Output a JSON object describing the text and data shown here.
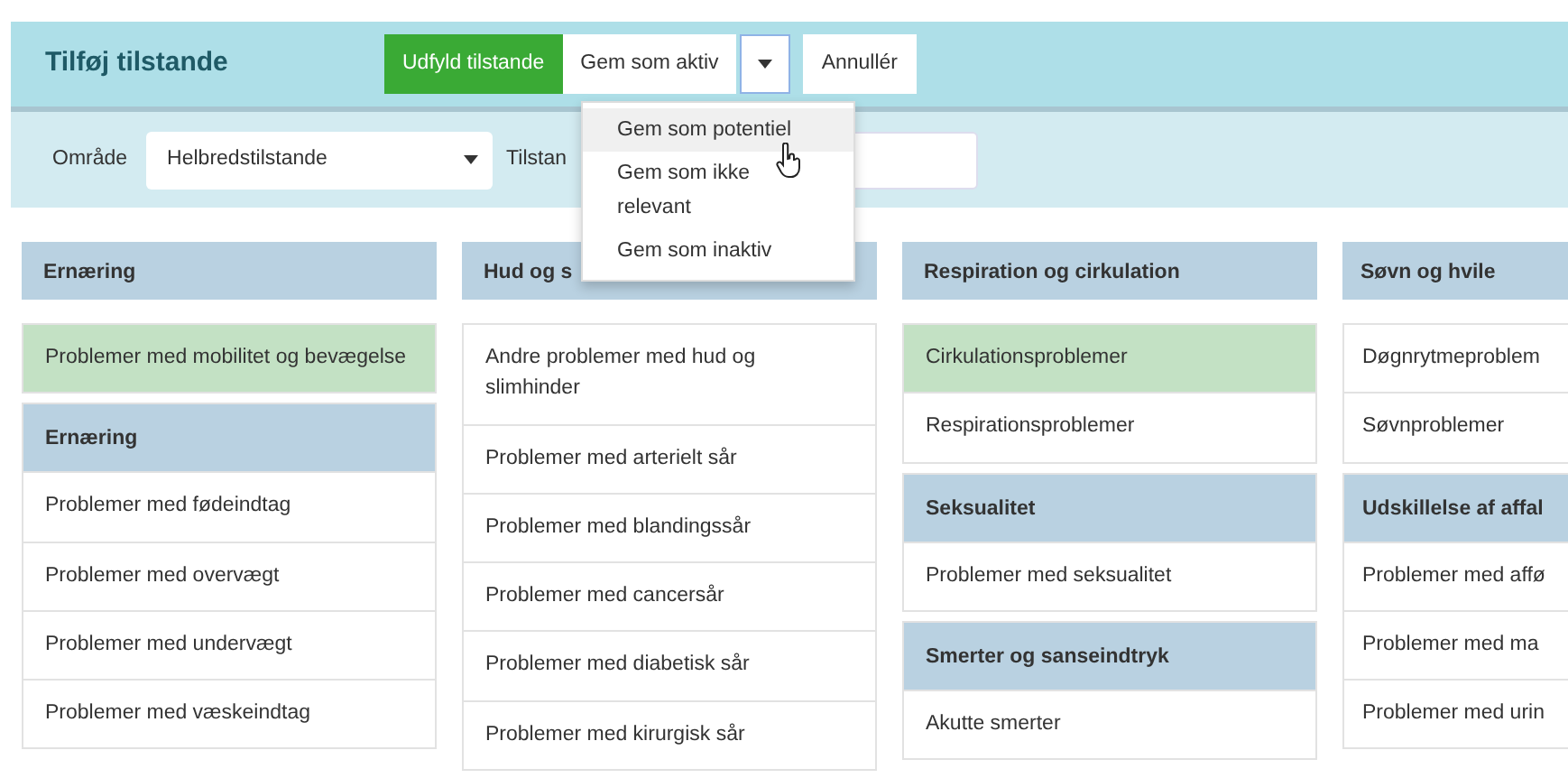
{
  "header": {
    "title": "Tilføj tilstande",
    "buttons": [
      {
        "label": "Udfyld tilstande",
        "kind": "primary"
      },
      {
        "label": "Gem som aktiv",
        "kind": "default"
      },
      {
        "kind": "caret",
        "focused": true
      },
      {
        "label": "Annullér",
        "kind": "default"
      }
    ]
  },
  "menu": {
    "items": [
      {
        "label": "Gem som potentiel",
        "selected": true
      },
      {
        "label": "Gem som ikke relevant",
        "selected": false
      },
      {
        "label": "Gem som inaktiv",
        "selected": false
      }
    ]
  },
  "filters": {
    "area_label": "Område",
    "area_value": "Helbredstilstande",
    "condition_label": "Tilstan"
  },
  "columns": [
    {
      "title": "Ernæring",
      "groups": [
        {
          "items": [
            {
              "label": "Problemer med mobilitet og bevægelse",
              "selected": true
            }
          ]
        },
        {
          "title": "Ernæring",
          "items": [
            {
              "label": "Problemer med fødeindtag",
              "selected": false
            },
            {
              "label": "Problemer med overvægt",
              "selected": false
            },
            {
              "label": "Problemer med undervægt",
              "selected": false
            },
            {
              "label": "Problemer med væskeindtag",
              "selected": false
            }
          ]
        }
      ]
    },
    {
      "title": "Hud og s",
      "groups": [
        {
          "items": [
            {
              "label": "Andre problemer med hud og slimhinder",
              "selected": false
            },
            {
              "label": "Problemer med arterielt sår",
              "selected": false
            },
            {
              "label": "Problemer med blandingssår",
              "selected": false
            },
            {
              "label": "Problemer med cancersår",
              "selected": false
            },
            {
              "label": "Problemer med diabetisk sår",
              "selected": false
            },
            {
              "label": "Problemer med kirurgisk sår",
              "selected": false
            }
          ]
        }
      ]
    },
    {
      "title": "Respiration og cirkulation",
      "groups": [
        {
          "items": [
            {
              "label": "Cirkulationsproblemer",
              "selected": true
            },
            {
              "label": "Respirationsproblemer",
              "selected": false
            }
          ]
        },
        {
          "title": "Seksualitet",
          "items": [
            {
              "label": "Problemer med seksualitet",
              "selected": false
            }
          ]
        },
        {
          "title": "Smerter og sanseindtryk",
          "items": [
            {
              "label": "Akutte smerter",
              "selected": false
            }
          ]
        }
      ]
    },
    {
      "title": "Søvn og hvile",
      "groups": [
        {
          "items": [
            {
              "label": "Døgnrytmeproblem",
              "selected": false
            },
            {
              "label": "Søvnproblemer",
              "selected": false
            }
          ]
        },
        {
          "title": "Udskillelse af affal",
          "items": [
            {
              "label": "Problemer med affø",
              "selected": false
            },
            {
              "label": "Problemer med ma",
              "selected": false
            },
            {
              "label": "Problemer med urin",
              "selected": false
            }
          ]
        }
      ]
    }
  ]
}
